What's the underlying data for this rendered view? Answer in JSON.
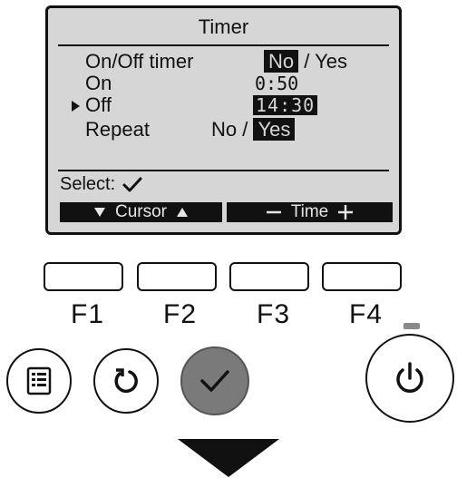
{
  "screen": {
    "title": "Timer",
    "rows": {
      "onoff_timer": {
        "label": "On/Off timer",
        "options": [
          "No",
          "Yes"
        ],
        "separator": " / ",
        "selected": "No"
      },
      "on": {
        "label": "On",
        "time": "0:50"
      },
      "off": {
        "label": "Off",
        "time": "14:30",
        "cursor": true
      },
      "repeat": {
        "label": "Repeat",
        "options": [
          "No",
          "Yes"
        ],
        "separator": " / ",
        "selected": "Yes"
      }
    },
    "select_label": "Select:",
    "softkeys": {
      "left": {
        "label": "Cursor"
      },
      "right": {
        "label": "Time"
      }
    }
  },
  "function_keys": [
    "F1",
    "F2",
    "F3",
    "F4"
  ],
  "buttons": {
    "menu": {
      "icon": "menu-icon"
    },
    "back": {
      "icon": "return-icon"
    },
    "ok": {
      "icon": "check-icon"
    },
    "power": {
      "icon": "power-icon"
    }
  },
  "colors": {
    "lcd_background": "#d6d6d6",
    "ok_button": "#7a7a7a",
    "led": "#8a8a8a"
  }
}
